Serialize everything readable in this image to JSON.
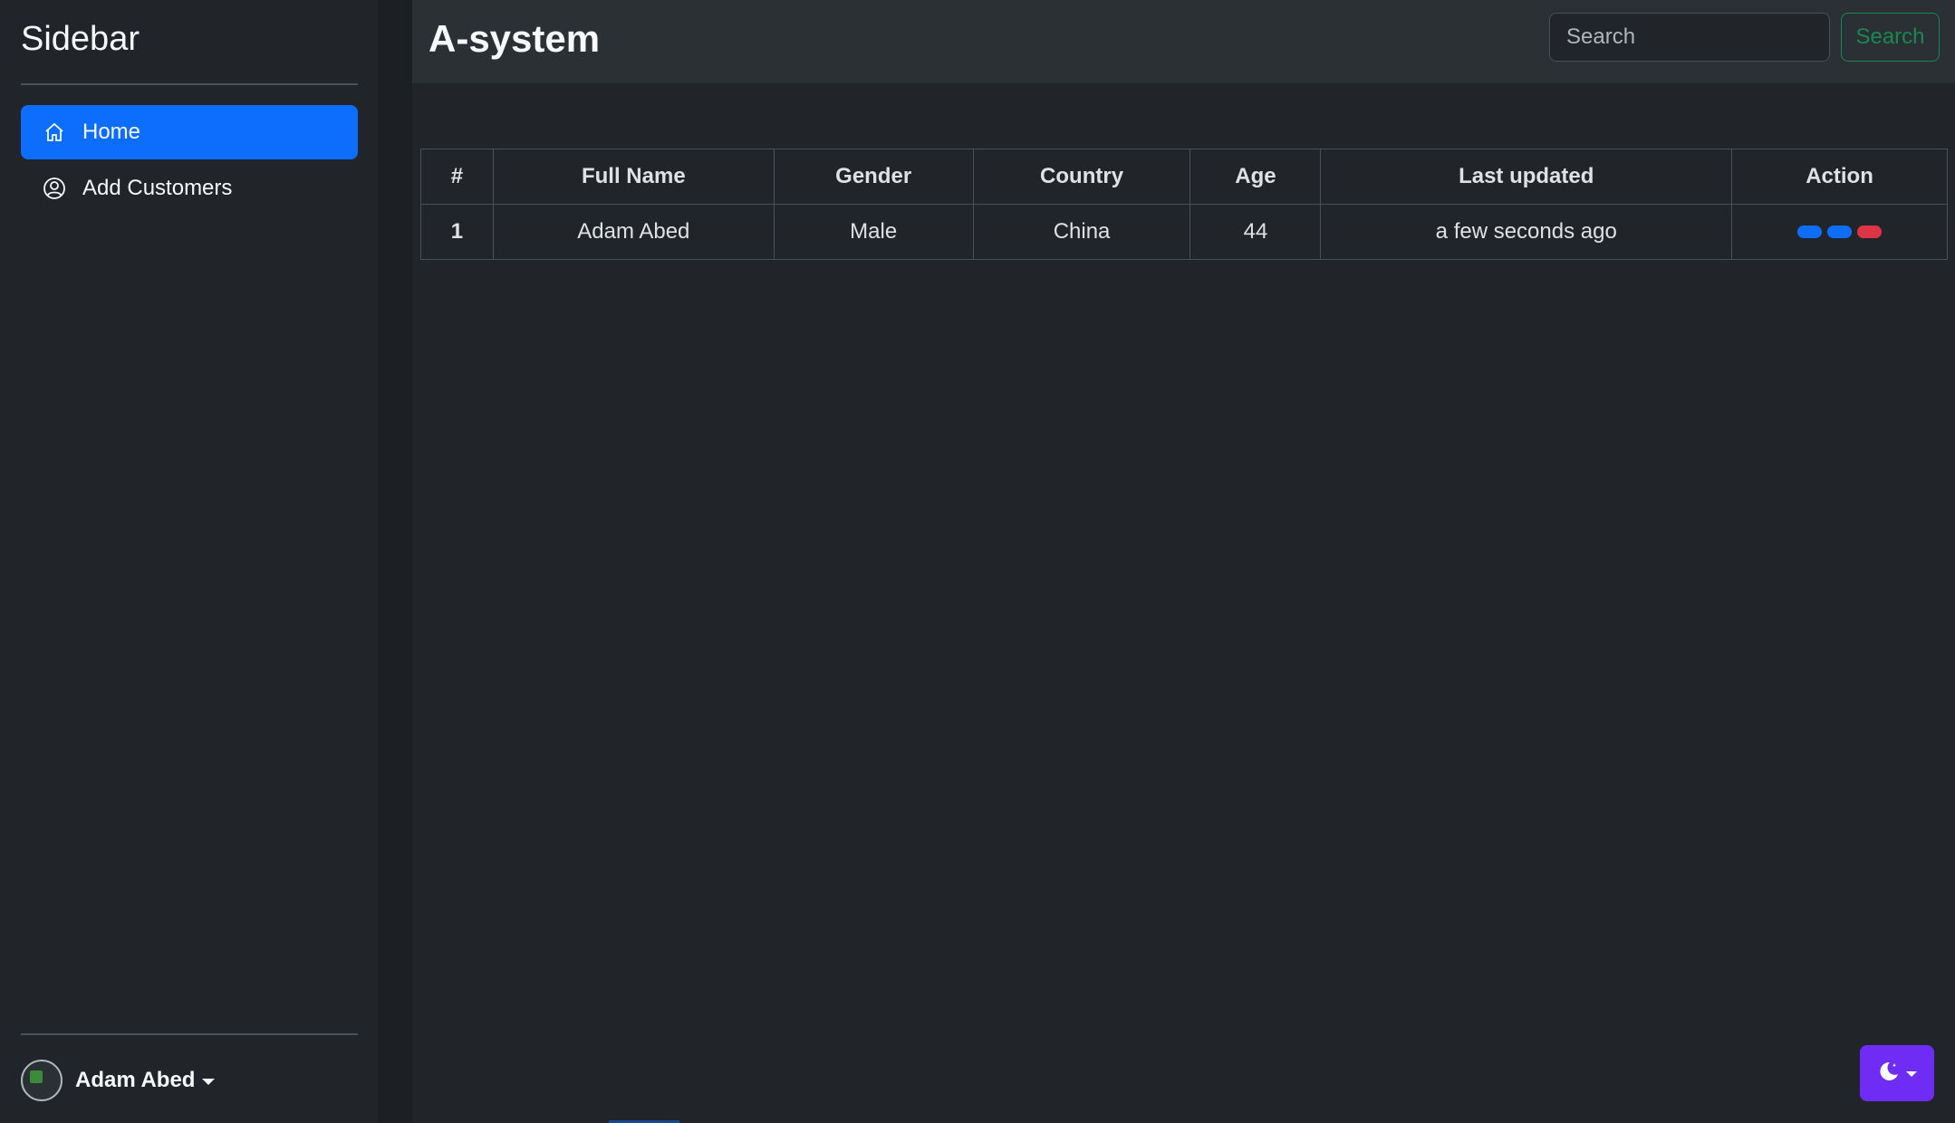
{
  "sidebar": {
    "title": "Sidebar",
    "items": [
      {
        "label": "Home",
        "icon": "home-icon",
        "active": true
      },
      {
        "label": "Add Customers",
        "icon": "user-circle-icon",
        "active": false
      }
    ],
    "user": {
      "name": "Adam Abed"
    }
  },
  "header": {
    "brand": "A-system",
    "search": {
      "placeholder": "Search",
      "value": "",
      "button_label": "Search"
    }
  },
  "table": {
    "columns": [
      "#",
      "Full Name",
      "Gender",
      "Country",
      "Age",
      "Last updated",
      "Action"
    ],
    "rows": [
      {
        "index": "1",
        "full_name": "Adam Abed",
        "gender": "Male",
        "country": "China",
        "age": "44",
        "last_updated": "a few seconds ago"
      }
    ]
  },
  "colors": {
    "primary": "#0d6efd",
    "danger": "#dc3545",
    "success": "#198754",
    "theme_toggle": "#6f2cf5",
    "background": "#212529"
  },
  "theme_toggle": {
    "icon": "moon-stars-icon"
  }
}
